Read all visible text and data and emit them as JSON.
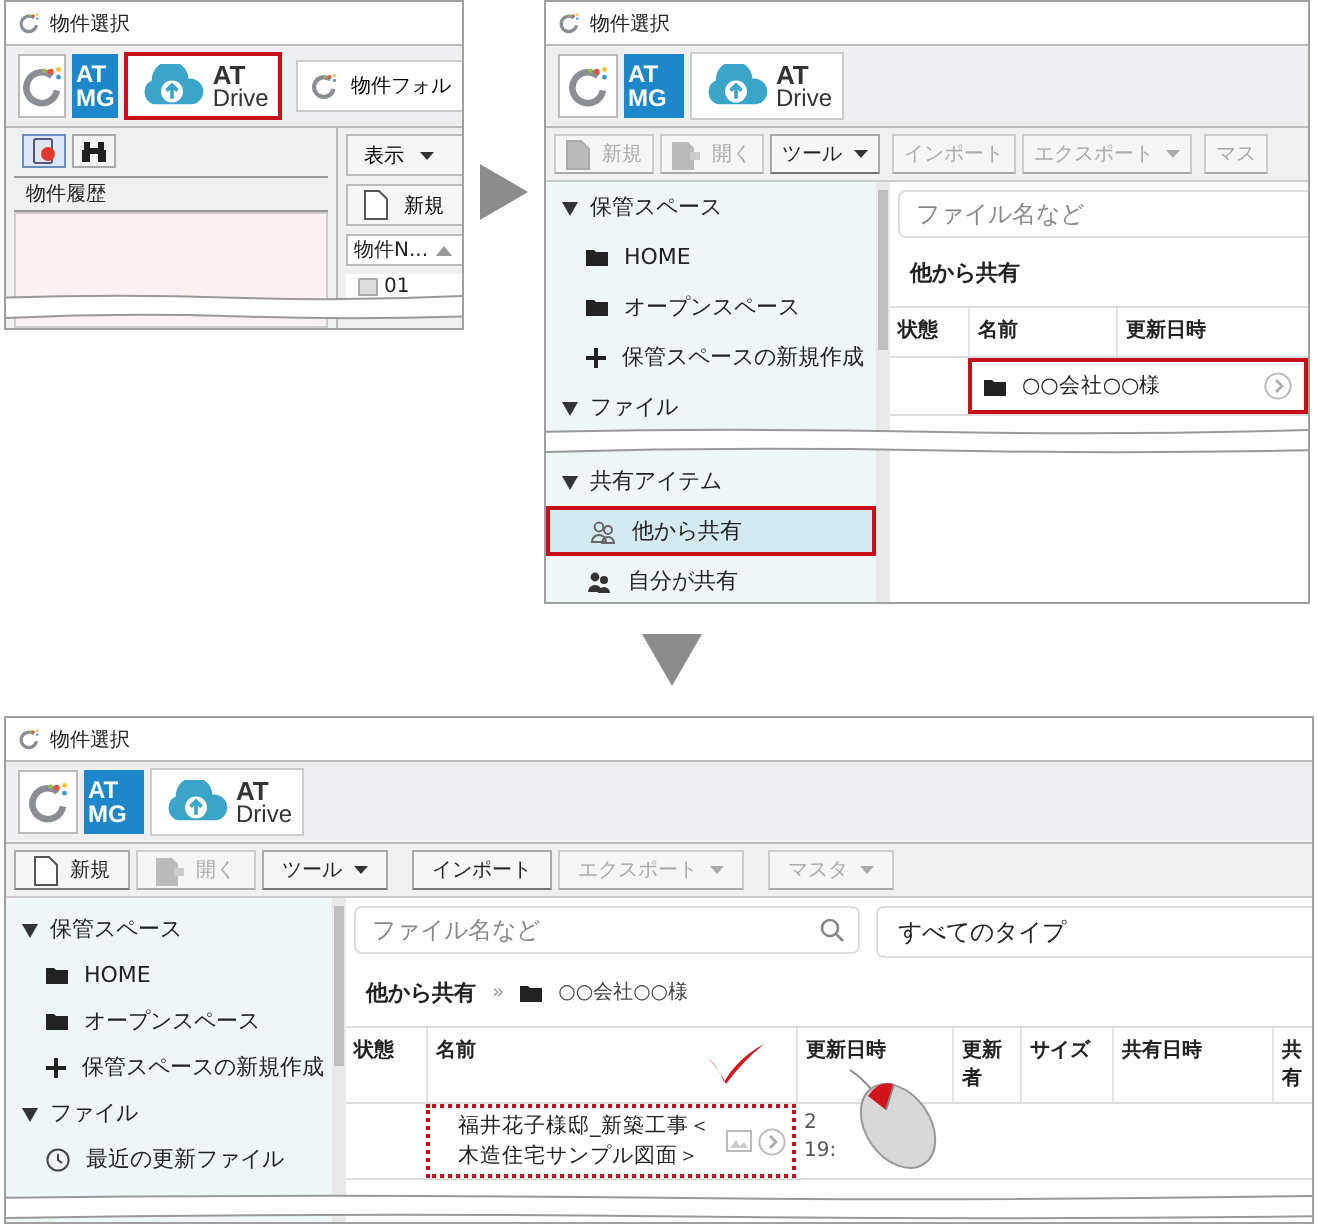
{
  "panels": [
    {
      "kind": "legacy",
      "window_title": "物件選択",
      "app_tabs": [
        {
          "kind": "ring",
          "highlighted": false
        },
        {
          "kind": "mg",
          "lines": [
            "AT",
            "MG"
          ],
          "highlighted": false
        },
        {
          "kind": "drive",
          "lines": [
            "AT",
            "Drive"
          ],
          "highlighted": true
        },
        {
          "kind": "ring_label",
          "label": "物件フォル",
          "highlighted": false
        }
      ],
      "left_pane": {
        "icon_tabs": [
          {
            "kind": "history",
            "selected": true
          },
          {
            "kind": "search",
            "selected": false
          }
        ],
        "header": "物件履歴"
      },
      "right_pane": {
        "buttons": [
          {
            "label": "表示",
            "dropdown": true
          },
          {
            "label": "新規",
            "dropdown": false
          }
        ],
        "list_header": "物件N...",
        "rows": [
          "01"
        ]
      }
    },
    {
      "kind": "drive",
      "window_title": "物件選択",
      "app_tabs": [
        {
          "kind": "ring",
          "highlighted": false
        },
        {
          "kind": "mg",
          "lines": [
            "AT",
            "MG"
          ],
          "highlighted": false
        },
        {
          "kind": "drive",
          "lines": [
            "AT",
            "Drive"
          ],
          "highlighted": false
        }
      ],
      "toolbar": [
        [
          {
            "kind": "new",
            "label": "新規",
            "disabled": true,
            "dropdown": false
          },
          {
            "kind": "open",
            "label": "開く",
            "disabled": true,
            "dropdown": false
          },
          {
            "kind": "plain",
            "label": "ツール",
            "disabled": false,
            "dropdown": true
          }
        ],
        [
          {
            "kind": "plain",
            "label": "インポート",
            "disabled": true,
            "dropdown": false
          },
          {
            "kind": "plain",
            "label": "エクスポート",
            "disabled": true,
            "dropdown": true
          }
        ],
        [
          {
            "kind": "plain",
            "label": "マス",
            "disabled": true,
            "dropdown": false
          }
        ]
      ],
      "sidebar": [
        {
          "label": "保管スペース",
          "expanded": true,
          "items": [
            {
              "kind": "folder",
              "label": "HOME",
              "selected": false,
              "highlighted": false
            },
            {
              "kind": "folder",
              "label": "オープンスペース",
              "selected": false,
              "highlighted": false
            },
            {
              "kind": "create",
              "label": "保管スペースの新規作成",
              "selected": false,
              "highlighted": false
            }
          ]
        },
        {
          "label": "ファイル",
          "expanded": true
        },
        {
          "label": "共有アイテム",
          "expanded": true,
          "items": [
            {
              "kind": "shared_with_me",
              "label": "他から共有",
              "selected": true,
              "highlighted": true
            },
            {
              "kind": "shared_by_me",
              "label": "自分が共有",
              "selected": false,
              "highlighted": false
            }
          ]
        }
      ],
      "search": {
        "placeholder": "ファイル名など"
      },
      "location": [
        {
          "kind": "text",
          "label": "他から共有"
        }
      ],
      "columns": [
        "状態",
        "名前",
        "更新日時"
      ],
      "rows": [
        {
          "kind": "folder",
          "name_lines": [
            "○○会社○○様"
          ],
          "highlighted": true,
          "clicked": false
        }
      ]
    },
    {
      "kind": "drive",
      "window_title": "物件選択",
      "app_tabs": [
        {
          "kind": "ring",
          "highlighted": false
        },
        {
          "kind": "mg",
          "lines": [
            "AT",
            "MG"
          ],
          "highlighted": false
        },
        {
          "kind": "drive",
          "lines": [
            "AT",
            "Drive"
          ],
          "highlighted": false
        }
      ],
      "toolbar": [
        [
          {
            "kind": "new",
            "label": "新規",
            "disabled": false,
            "dropdown": false
          },
          {
            "kind": "open",
            "label": "開く",
            "disabled": true,
            "dropdown": false
          },
          {
            "kind": "plain",
            "label": "ツール",
            "disabled": false,
            "dropdown": true
          }
        ],
        [
          {
            "kind": "plain",
            "label": "インポート",
            "disabled": false,
            "dropdown": false
          },
          {
            "kind": "plain",
            "label": "エクスポート",
            "disabled": true,
            "dropdown": true
          }
        ],
        [
          {
            "kind": "plain",
            "label": "マスタ",
            "disabled": true,
            "dropdown": true
          }
        ]
      ],
      "sidebar": [
        {
          "label": "保管スペース",
          "expanded": true,
          "items": [
            {
              "kind": "folder",
              "label": "HOME",
              "selected": false,
              "highlighted": false
            },
            {
              "kind": "folder",
              "label": "オープンスペース",
              "selected": false,
              "highlighted": false
            },
            {
              "kind": "create",
              "label": "保管スペースの新規作成",
              "selected": false,
              "highlighted": false
            }
          ]
        },
        {
          "label": "ファイル",
          "expanded": true,
          "items": [
            {
              "kind": "recent",
              "label": "最近の更新ファイル",
              "selected": false,
              "highlighted": false
            }
          ]
        }
      ],
      "search": {
        "placeholder": "ファイル名など",
        "icon": true
      },
      "type_filter": "すべてのタイプ",
      "location": [
        {
          "kind": "text",
          "label": "他から共有"
        },
        {
          "kind": "separator",
          "label": "»"
        },
        {
          "kind": "folder",
          "label": "○○会社○○様"
        }
      ],
      "columns": [
        "状態",
        "名前",
        "更新日時",
        "更新者",
        "サイズ",
        "共有日時",
        "共有"
      ],
      "rows": [
        {
          "kind": "file",
          "name_lines": [
            "福井花子様邸_新築工事＜",
            "木造住宅サンプル図面＞"
          ],
          "highlighted": false,
          "focused": true,
          "updated": [
            "2",
            "19:"
          ],
          "clicked": true
        }
      ]
    }
  ]
}
